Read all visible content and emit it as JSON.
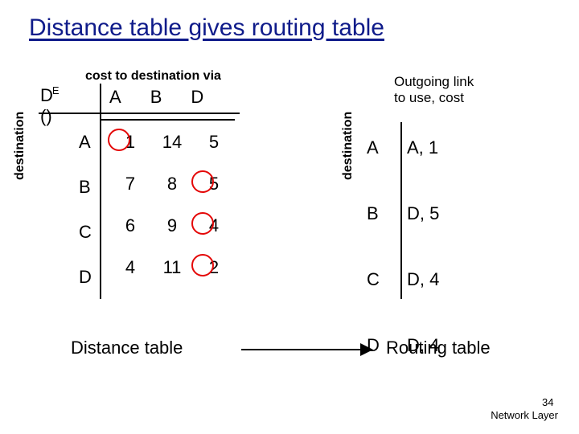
{
  "title": "Distance table gives routing table",
  "cost_label": "cost to destination via",
  "outgoing_label_l1": "Outgoing link",
  "outgoing_label_l2": "to use, cost",
  "de_symbol": "D",
  "de_sup": "E",
  "de_paren": "()",
  "cols": [
    "A",
    "B",
    "D"
  ],
  "rows": [
    "A",
    "B",
    "C",
    "D"
  ],
  "cells": [
    [
      "1",
      "14",
      "5"
    ],
    [
      "7",
      "8",
      "5"
    ],
    [
      "6",
      "9",
      "4"
    ],
    [
      "4",
      "11",
      "2"
    ]
  ],
  "routing": [
    {
      "k": "A",
      "v": "A, 1"
    },
    {
      "k": "B",
      "v": "D, 5"
    },
    {
      "k": "C",
      "v": "D, 4"
    },
    {
      "k": "D",
      "v": "D, 4"
    }
  ],
  "dest_label": "destination",
  "distance_table_label": "Distance table",
  "routing_table_label": "Routing table",
  "footer_text": "Network Layer",
  "page_num": "34",
  "chart_data": {
    "type": "table",
    "title": "Distance table gives routing table",
    "distance_table": {
      "node": "E",
      "via": [
        "A",
        "B",
        "D"
      ],
      "destinations": [
        "A",
        "B",
        "C",
        "D"
      ],
      "costs": {
        "A": {
          "A": 1,
          "B": 14,
          "D": 5
        },
        "B": {
          "A": 7,
          "B": 8,
          "D": 5
        },
        "C": {
          "A": 6,
          "B": 9,
          "D": 4
        },
        "D": {
          "A": 4,
          "B": 11,
          "D": 2
        }
      },
      "min_highlight": {
        "A": "A",
        "B": "D",
        "C": "D",
        "D": "D"
      }
    },
    "routing_table": {
      "A": {
        "next_hop": "A",
        "cost": 1
      },
      "B": {
        "next_hop": "D",
        "cost": 5
      },
      "C": {
        "next_hop": "D",
        "cost": 4
      },
      "D": {
        "next_hop": "D",
        "cost": 4
      }
    }
  }
}
